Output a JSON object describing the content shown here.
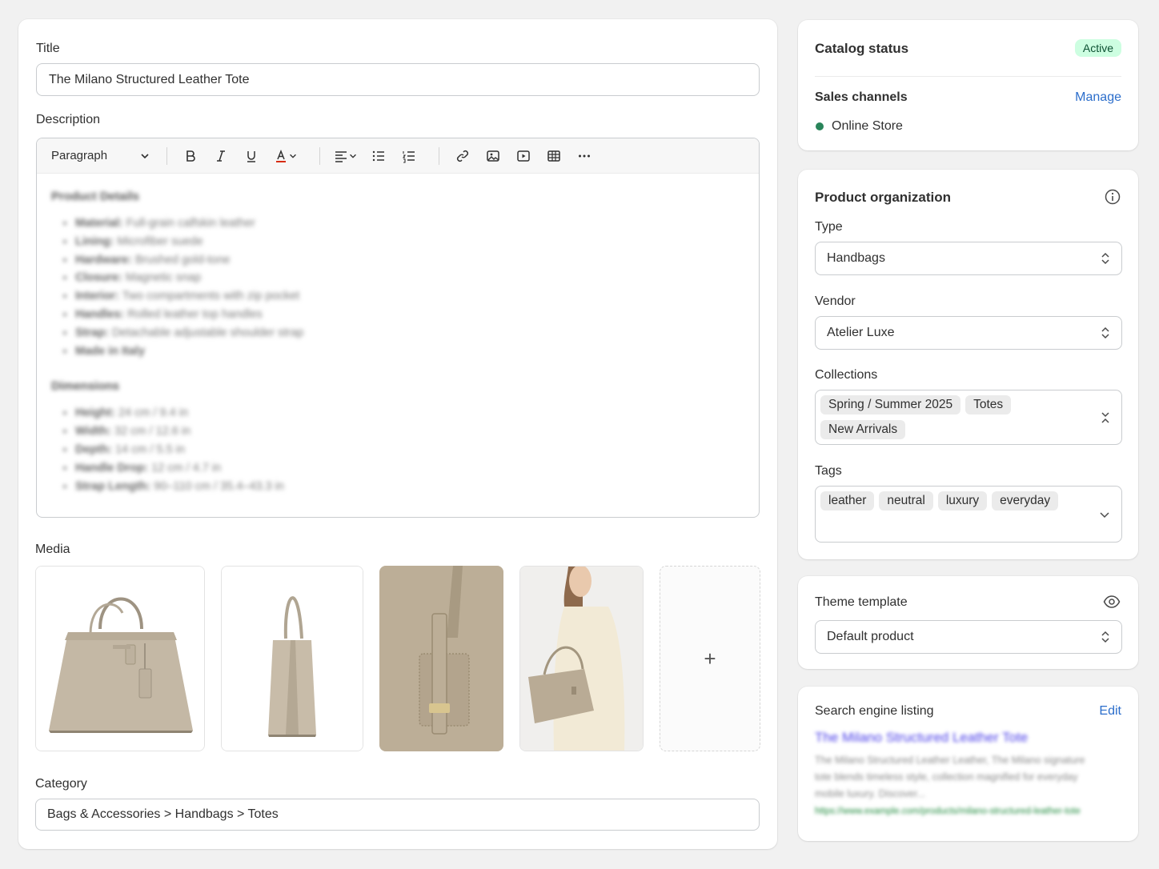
{
  "main": {
    "title_label": "Title",
    "title_value": "The Milano Structured Leather Tote",
    "description_label": "Description",
    "toolbar": {
      "format_select": "Paragraph"
    },
    "description": {
      "section1_heading": "Product Details",
      "section1_items": [
        {
          "key": "Material:",
          "value": "Full-grain calfskin leather"
        },
        {
          "key": "Lining:",
          "value": "Microfiber suede"
        },
        {
          "key": "Hardware:",
          "value": "Brushed gold-tone"
        },
        {
          "key": "Closure:",
          "value": "Magnetic snap"
        },
        {
          "key": "Interior:",
          "value": "Two compartments with zip pocket"
        },
        {
          "key": "Handles:",
          "value": "Rolled leather top handles"
        },
        {
          "key": "Strap:",
          "value": "Detachable adjustable shoulder strap"
        },
        {
          "key": "Made in Italy",
          "value": ""
        }
      ],
      "section2_heading": "Dimensions",
      "section2_items": [
        {
          "key": "Height:",
          "value": "24 cm / 9.4 in"
        },
        {
          "key": "Width:",
          "value": "32 cm / 12.6 in"
        },
        {
          "key": "Depth:",
          "value": "14 cm / 5.5 in"
        },
        {
          "key": "Handle Drop:",
          "value": "12 cm / 4.7 in"
        },
        {
          "key": "Strap Length:",
          "value": "90–110 cm / 35.4–43.3 in"
        }
      ]
    },
    "media_label": "Media",
    "media_add": "+",
    "category_label": "Category",
    "category_value": "Bags & Accessories > Handbags > Totes"
  },
  "status_card": {
    "title": "Catalog status",
    "badge": "Active",
    "sales_channels": "Sales channels",
    "manage": "Manage",
    "channel": "Online Store"
  },
  "org_card": {
    "title": "Product organization",
    "type_label": "Type",
    "type_value": "Handbags",
    "vendor_label": "Vendor",
    "vendor_value": "Atelier Luxe",
    "collections_label": "Collections",
    "collections": [
      "Spring / Summer 2025",
      "Totes",
      "New Arrivals"
    ],
    "tags_label": "Tags",
    "tags": [
      "leather",
      "neutral",
      "luxury",
      "everyday"
    ]
  },
  "theme_card": {
    "title": "Theme template",
    "value": "Default product"
  },
  "seo_card": {
    "title": "Search engine listing",
    "edit": "Edit",
    "seo_title": "The Milano Structured Leather Tote",
    "seo_desc": "The Milano Structured Leather Leather, The Milano signature tote blends timeless style, collection magnified for everyday mobile luxury. Discover...",
    "seo_url": "https://www.example.com/products/milano-structured-leather-tote"
  },
  "colors": {
    "accent": "#2c6ecb",
    "success": "#29845a",
    "badge_bg": "#cdfee1",
    "seo_link": "#4a3ee8",
    "seo_url": "#1e8a3c"
  }
}
